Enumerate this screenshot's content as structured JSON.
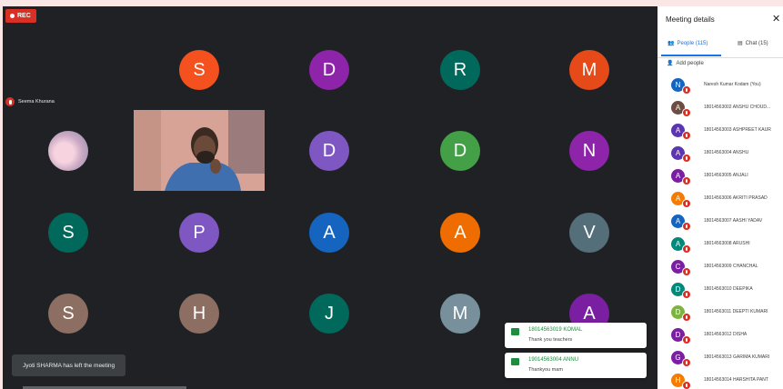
{
  "meeting": {
    "rec_label": "REC",
    "presenter_name": "Seema Khurana",
    "toast": "Jyoti SHARMA has left the meeting"
  },
  "tiles": [
    {
      "letter": "S",
      "color": "#f4511e"
    },
    {
      "letter": "D",
      "color": "#8e24aa"
    },
    {
      "letter": "R",
      "color": "#00695c"
    },
    {
      "letter": "M",
      "color": "#e64a19"
    },
    {
      "letter": "D",
      "color": "#7e57c2"
    },
    {
      "letter": "D",
      "color": "#43a047"
    },
    {
      "letter": "N",
      "color": "#8e24aa"
    },
    {
      "letter": "S",
      "color": "#00695c"
    },
    {
      "letter": "P",
      "color": "#7e57c2"
    },
    {
      "letter": "A",
      "color": "#1565c0"
    },
    {
      "letter": "A",
      "color": "#ef6c00"
    },
    {
      "letter": "V",
      "color": "#546e7a"
    },
    {
      "letter": "S",
      "color": "#8d6e63"
    },
    {
      "letter": "H",
      "color": "#8d6e63"
    },
    {
      "letter": "J",
      "color": "#00695c"
    },
    {
      "letter": "M",
      "color": "#78909c"
    },
    {
      "letter": "A",
      "color": "#7b1fa2"
    }
  ],
  "chat_popups": [
    {
      "name": "18014563019 KOMAL",
      "message": "Thank you teachers"
    },
    {
      "name": "19014563004 ANNU",
      "message": "Thankyou mam"
    }
  ],
  "panel": {
    "title": "Meeting details",
    "people_tab": "People (115)",
    "chat_tab": "Chat (15)",
    "add_people": "Add people",
    "people": [
      {
        "initial": "N",
        "color": "#1565c0",
        "name": "Naresh Kumar Kodam (You)"
      },
      {
        "initial": "A",
        "color": "#6d4c41",
        "name": "18014563002 ANSHU CHOUD..."
      },
      {
        "initial": "A",
        "color": "#5e35b1",
        "name": "18014563003 ASHPREET KAUR"
      },
      {
        "initial": "A",
        "color": "#5e35b1",
        "name": "18014563004 ANSHU"
      },
      {
        "initial": "A",
        "color": "#7b1fa2",
        "name": "18014563005 ANJALI"
      },
      {
        "initial": "A",
        "color": "#f57c00",
        "name": "18014563006 AKRITI PRASAD"
      },
      {
        "initial": "A",
        "color": "#1565c0",
        "name": "18014563007 AASHI YADAV"
      },
      {
        "initial": "A",
        "color": "#00897b",
        "name": "18014563008 ARUSHI"
      },
      {
        "initial": "C",
        "color": "#7b1fa2",
        "name": "18014563009 CHANCHAL"
      },
      {
        "initial": "D",
        "color": "#00897b",
        "name": "18014563010 DEEPIKA"
      },
      {
        "initial": "D",
        "color": "#7cb342",
        "name": "18014563011 DEEPTI KUMARI"
      },
      {
        "initial": "D",
        "color": "#7b1fa2",
        "name": "18014563012 DISHA"
      },
      {
        "initial": "G",
        "color": "#7b1fa2",
        "name": "18014563013 GARIMA KUMARI"
      },
      {
        "initial": "H",
        "color": "#f57c00",
        "name": "18014563014 HARSHITA PANT"
      }
    ]
  }
}
